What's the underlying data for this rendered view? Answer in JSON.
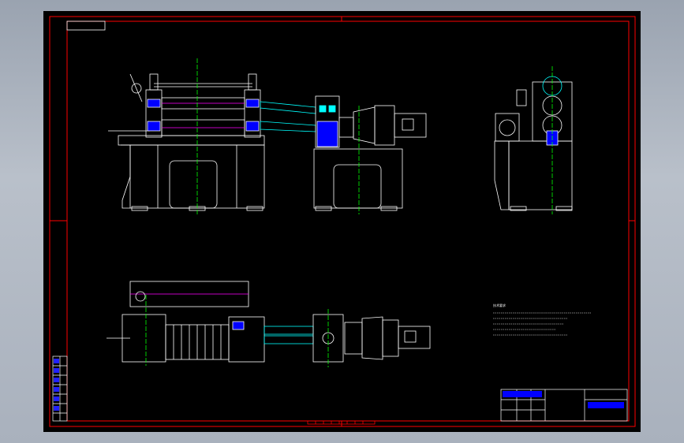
{
  "drawing": {
    "background_color": "#000000",
    "frame_color": "#ff0000",
    "outline_color": "#ffffff",
    "part_color": "#0000ff",
    "shaft_color": "#00ffff",
    "center_line_color": "#00ff00",
    "hatch_color": "#ff00ff",
    "views": [
      "front-view",
      "side-view",
      "top-view"
    ],
    "technical_requirements": {
      "title": "技术要求",
      "line_count": 5
    },
    "title_block": {
      "cells": 6
    }
  }
}
